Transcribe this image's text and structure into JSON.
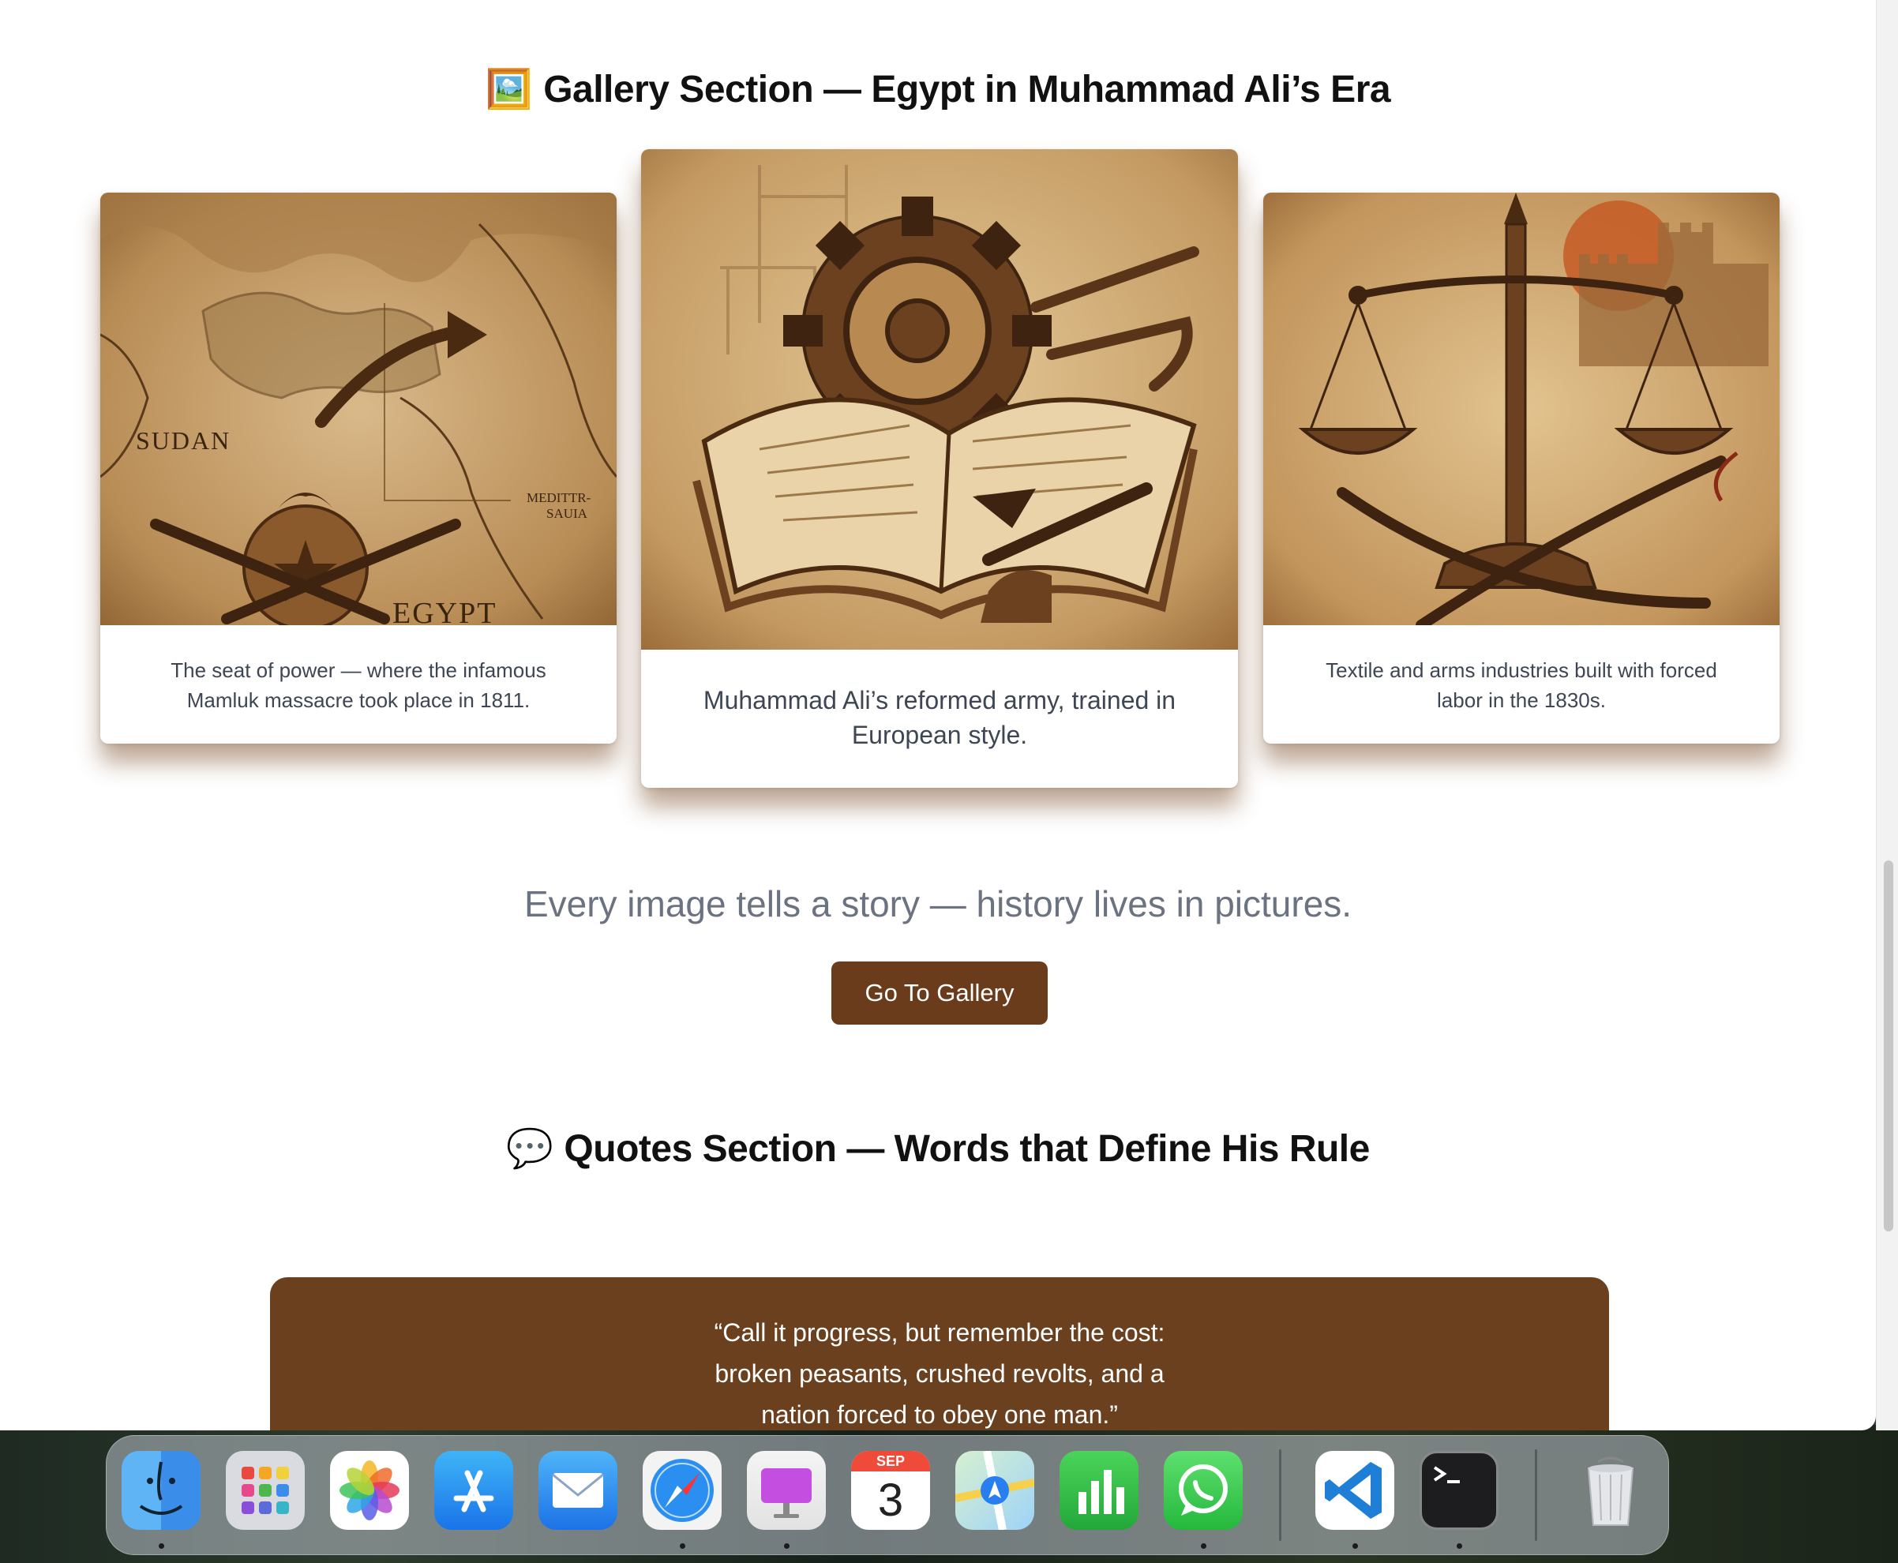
{
  "gallery": {
    "emoji": "🖼️",
    "title": "Gallery Section — Egypt in Muhammad Ali’s Era",
    "cards": [
      {
        "caption_line1": "The seat of power — where the infamous",
        "caption_line2": "Mamluk massacre took place in 1811.",
        "map_labels": {
          "sudan": "SUDAN",
          "egypt": "EGYPT",
          "sea1": "MEDITTR-",
          "sea2": "SAUIA"
        }
      },
      {
        "caption_line1": "Muhammad Ali’s reformed army, trained in",
        "caption_line2": "European style."
      },
      {
        "caption_line1": "Textile and arms industries built with forced",
        "caption_line2": "labor in the 1830s."
      }
    ],
    "tagline": "Every image tells a story — history lives in pictures.",
    "button_label": "Go To Gallery"
  },
  "quotes": {
    "emoji": "💬",
    "title": "Quotes Section — Words that Define His Rule",
    "quote_line1": "“Call it progress, but remember the cost:",
    "quote_line2": "broken peasants, crushed revolts, and a",
    "quote_line3": "nation forced to obey one man.”"
  },
  "dock": {
    "calendar_month": "SEP",
    "calendar_day": "3",
    "apps": [
      "finder-icon",
      "launchpad-icon",
      "photos-icon",
      "app-store-icon",
      "mail-icon",
      "safari-icon",
      "keynote-icon",
      "calendar-icon",
      "maps-icon",
      "numbers-icon",
      "whatsapp-icon",
      "vscode-icon",
      "terminal-icon",
      "trash-icon"
    ]
  },
  "colors": {
    "accent_brown": "#6b3c1b",
    "quote_bg": "#6b401f",
    "sepia": "#c9a06a"
  }
}
